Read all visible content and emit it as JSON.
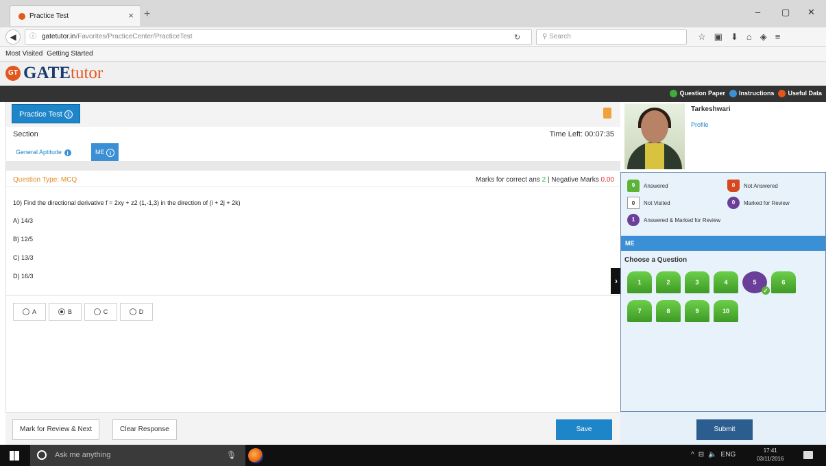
{
  "browser": {
    "tab_title": "Practice Test",
    "tab_close": "×",
    "new_tab": "+",
    "min": "–",
    "max": "▢",
    "close": "✕",
    "url_host": "gatetutor.in",
    "url_path": "/Favorites/PracticeCenter/PracticeTest",
    "search_placeholder": "Search",
    "bookmarks": [
      "Most Visited",
      "Getting Started"
    ]
  },
  "site": {
    "logo_badge": "GT",
    "logo_gate": "GATE",
    "logo_tutor": "tutor",
    "top_links": [
      "Question Paper",
      "Instructions",
      "Useful Data"
    ],
    "top_link_colors": [
      "#3cae3c",
      "#3b8fd4",
      "#e2571d"
    ]
  },
  "test": {
    "practice_test_label": "Practice Test",
    "section_label": "Section",
    "time_left": "Time Left: 00:07:35",
    "section_tabs": [
      "General Aptitude",
      "ME"
    ],
    "question_type": "Question Type: MCQ",
    "marks_prefix": "Marks for correct ans",
    "marks_correct": "2",
    "marks_sep": "| Negative Marks",
    "marks_negative": "0.00",
    "question": "10) Find the directional derivative f = 2xy + z2  (1,-1,3) in the direction of (i + 2j + 2k)",
    "options": [
      "A) 14/3",
      "B) 12/5",
      "C) 13/3",
      "D) 16/3"
    ],
    "radio_labels": [
      "A",
      "B",
      "C",
      "D"
    ],
    "selected": "B",
    "buttons": {
      "mark_review": "Mark for Review & Next",
      "clear": "Clear Response",
      "save": "Save",
      "submit": "Submit"
    }
  },
  "student": {
    "name": "Tarkeshwari",
    "profile_link": "Profile"
  },
  "legend": {
    "answered": {
      "count": "9",
      "label": "Answered"
    },
    "not_answered": {
      "count": "0",
      "label": "Not Answered"
    },
    "not_visited": {
      "count": "0",
      "label": "Not Visited"
    },
    "marked_review": {
      "count": "0",
      "label": "Marked for Review"
    },
    "answered_marked": {
      "count": "1",
      "label": "Answered & Marked for Review"
    }
  },
  "palette": {
    "section_bar": "ME",
    "choose_label": "Choose a Question",
    "questions": [
      "1",
      "2",
      "3",
      "4",
      "5",
      "6",
      "7",
      "8",
      "9",
      "10"
    ],
    "review_question": "5"
  },
  "taskbar": {
    "search_text": "Ask me anything",
    "lang": "ENG",
    "time": "17:41",
    "date": "03/11/2016"
  }
}
